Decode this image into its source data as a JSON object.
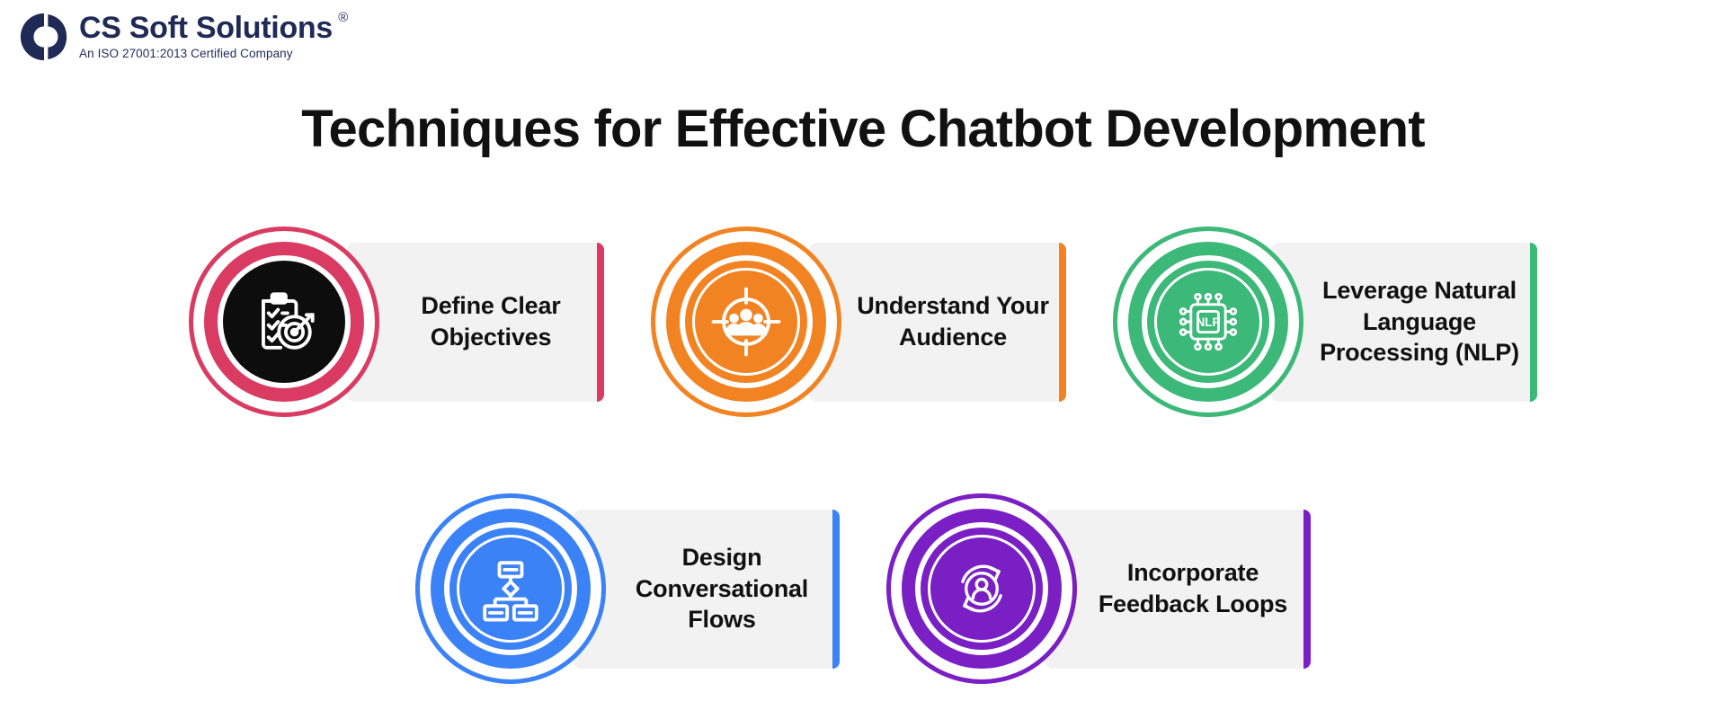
{
  "brand": {
    "logo_mark_name": "cs-soft-solutions-logo",
    "wordmark": "CS Soft Solutions",
    "registered_symbol": "®",
    "tagline": "An ISO 27001:2013 Certified Company",
    "logo_color": "#1F2A56"
  },
  "header": {
    "title": "Techniques for Effective Chatbot Development"
  },
  "cards": [
    {
      "id": "define-clear-objectives",
      "label": "Define Clear Objectives",
      "accent": "#D93B63",
      "disc": "#0D0D0D",
      "icon": "clipboard-target-icon",
      "inner_ring": false
    },
    {
      "id": "understand-your-audience",
      "label": "Understand Your Audience",
      "accent": "#F28322",
      "disc": "#F28322",
      "icon": "audience-crosshair-icon",
      "inner_ring": true
    },
    {
      "id": "leverage-nlp",
      "label": "Leverage Natural Language Processing (NLP)",
      "accent": "#3CB878",
      "disc": "#3CB878",
      "icon": "nlp-chip-icon",
      "inner_ring": true
    },
    {
      "id": "design-conversational-flows",
      "label": "Design Conversational Flows",
      "accent": "#3B82F6",
      "disc": "#3B82F6",
      "icon": "flowchart-icon",
      "inner_ring": true
    },
    {
      "id": "incorporate-feedback-loops",
      "label": "Incorporate Feedback Loops",
      "accent": "#7A1FC4",
      "disc": "#7A1FC4",
      "icon": "feedback-loop-icon",
      "inner_ring": true
    }
  ],
  "icon_text": {
    "nlp_chip_label": "NLP"
  }
}
